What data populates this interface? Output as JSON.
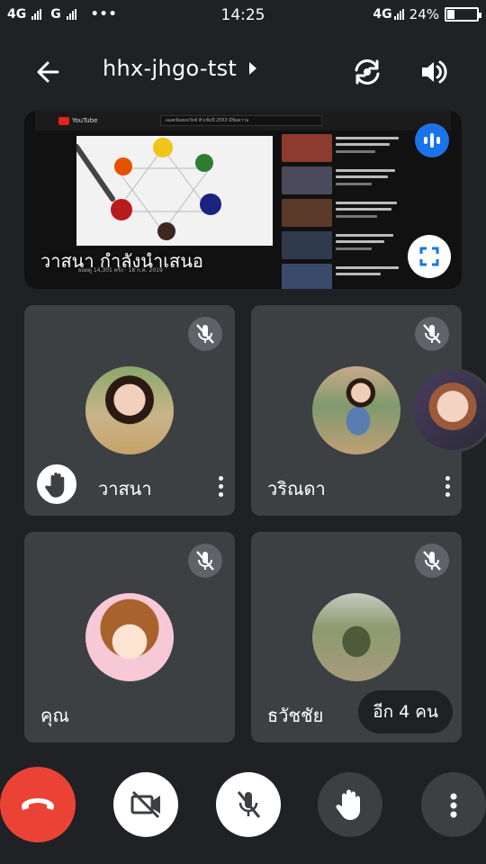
{
  "status_bar": {
    "left_network_1": "4G",
    "left_network_2": "G",
    "more_indicator": "•••",
    "time": "14:25",
    "right_network": "4G",
    "battery_percent": "24%",
    "battery_level": 0.24
  },
  "header": {
    "meeting_code": "hhx-jhgo-tst",
    "back_icon": "arrow-left-icon",
    "switch_camera_icon": "switch-camera-icon",
    "speaker_icon": "volume-icon"
  },
  "presentation": {
    "caption": "วาสนา กำลังนำเสนอ",
    "meta_text": "ยอดดู 14,301 ครั้ง · 18 ก.ค. 2019",
    "search_text": "เฉลยข้อสอบวิทย์ ติวเข้มปี 2563 มีข้อความ",
    "site_name": "YouTube",
    "accent_color": "#1a73e8"
  },
  "participants": [
    {
      "name": "วาสนา",
      "muted": true,
      "hand_raised": true
    },
    {
      "name": "วริณดา",
      "muted": true,
      "hand_raised": false
    },
    {
      "name": "คุณ",
      "muted": true,
      "hand_raised": false
    },
    {
      "name": "ธวัชชัย",
      "muted": true,
      "hand_raised": false,
      "others_label": "อีก 4 คน"
    }
  ],
  "controls": {
    "end_call_icon": "phone-hangup-icon",
    "camera_icon": "video-off-icon",
    "mic_icon": "mic-off-icon",
    "hand_icon": "raise-hand-icon",
    "more_icon": "more-vertical-icon",
    "end_call_color": "#ea4335"
  }
}
